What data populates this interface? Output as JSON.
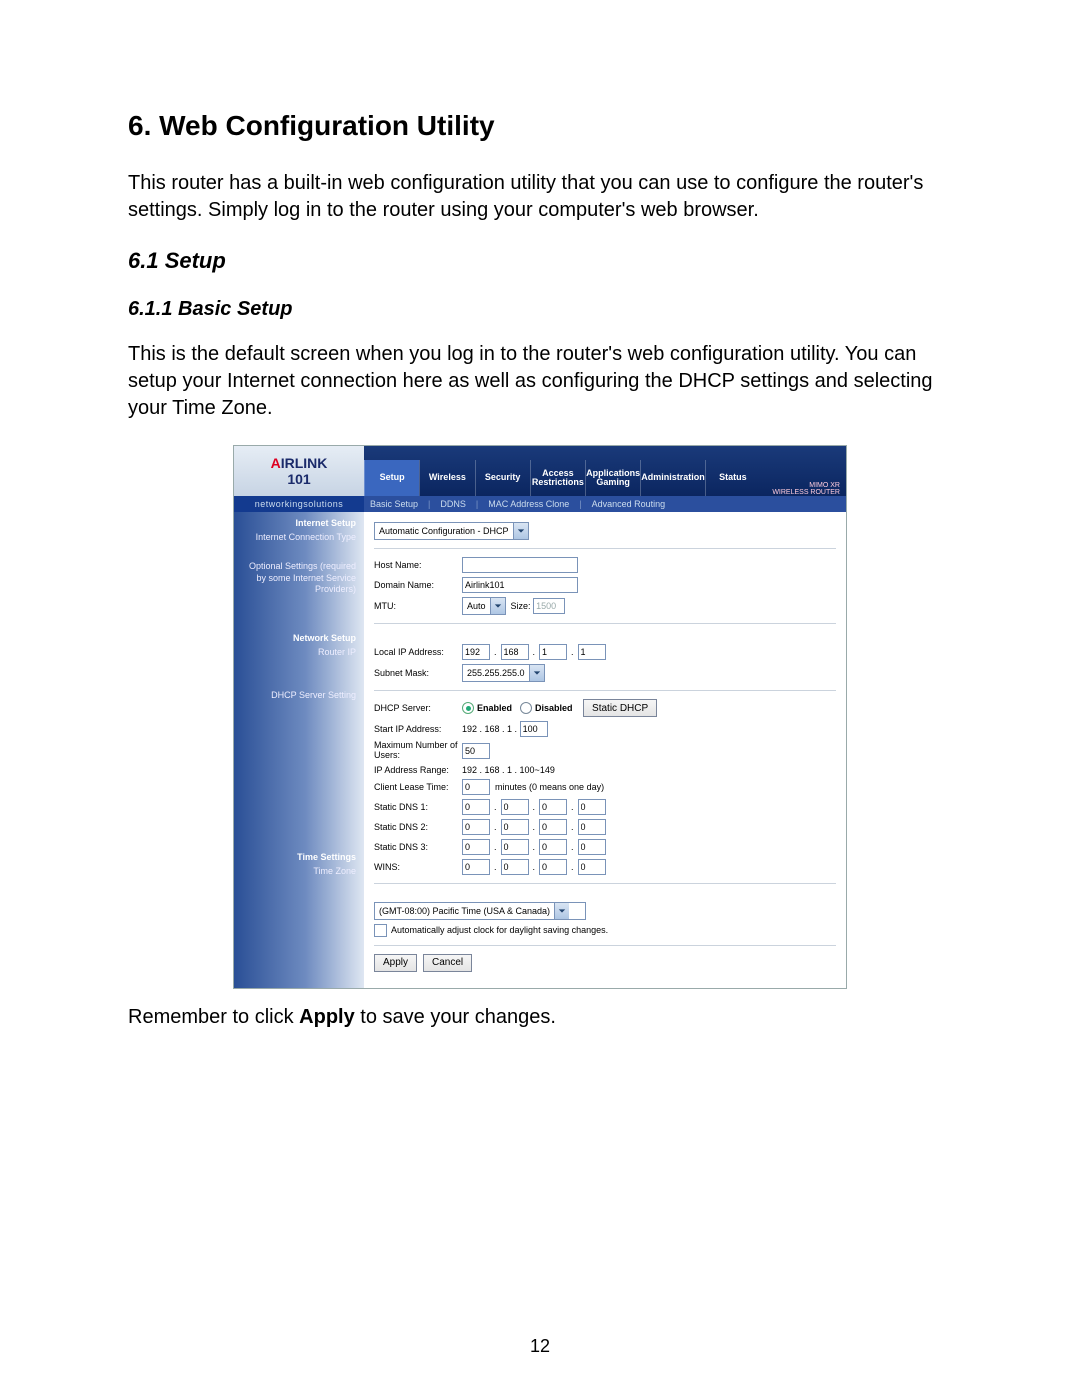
{
  "doc": {
    "h1": "6. Web Configuration Utility",
    "intro": "This router has a built-in web configuration utility that you can use to configure the router's settings. Simply log in to the router using your computer's web browser.",
    "h2": "6.1 Setup",
    "h3": "6.1.1 Basic Setup",
    "para2": "This is the default screen when you log in to the router's web configuration utility. You can setup your Internet connection here as well as configuring the DHCP settings and selecting your Time Zone.",
    "outro_pre": "Remember to click ",
    "outro_bold": "Apply",
    "outro_post": " to save your changes.",
    "pagenum": "12"
  },
  "router": {
    "badge_line1": "MIMO XR",
    "badge_line2": "WIRELESS ROUTER",
    "brand": {
      "pre": "A",
      "mid": "IRLINK",
      "small": "101"
    },
    "brandline": "networkingsolutions",
    "tabs": [
      "Setup",
      "Wireless",
      "Security",
      "Access Restrictions",
      "Applications Gaming",
      "Administration",
      "Status"
    ],
    "active_tab": 0,
    "subtabs": [
      "Basic Setup",
      "DDNS",
      "MAC Address Clone",
      "Advanced Routing"
    ],
    "left": {
      "internet_setup": "Internet Setup",
      "ict": "Internet Connection Type",
      "opt_settings": "Optional Settings (required by some Internet Service Providers)",
      "network_setup": "Network Setup",
      "router_ip": "Router IP",
      "dhcp_setting": "DHCP Server Setting",
      "time_settings": "Time Settings",
      "time_zone": "Time Zone"
    },
    "fields": {
      "conn_type": "Automatic Configuration - DHCP",
      "host_name_label": "Host Name:",
      "host_name": "",
      "domain_name_label": "Domain Name:",
      "domain_name": "Airlink101",
      "mtu_label": "MTU:",
      "mtu_mode": "Auto",
      "mtu_size_label": "Size:",
      "mtu_size": "1500",
      "local_ip_label": "Local IP Address:",
      "local_ip": [
        "192",
        "168",
        "1",
        "1"
      ],
      "subnet_label": "Subnet Mask:",
      "subnet": "255.255.255.0",
      "dhcp_server_label": "DHCP Server:",
      "enabled": "Enabled",
      "disabled": "Disabled",
      "static_dhcp_btn": "Static DHCP",
      "start_ip_label": "Start IP Address:",
      "start_ip_prefix": "192 . 168 . 1 .",
      "start_ip_last": "100",
      "max_users_label": "Maximum Number of Users:",
      "max_users": "50",
      "ip_range_label": "IP Address Range:",
      "ip_range": "192 . 168 . 1 . 100~149",
      "lease_label": "Client Lease Time:",
      "lease": "0",
      "lease_suffix": "minutes (0 means one day)",
      "dns1_label": "Static DNS 1:",
      "dns2_label": "Static DNS 2:",
      "dns3_label": "Static DNS 3:",
      "wins_label": "WINS:",
      "zero": "0",
      "tz": "(GMT-08:00) Pacific Time (USA & Canada)",
      "dst_label": "Automatically adjust clock for daylight saving changes.",
      "apply": "Apply",
      "cancel": "Cancel"
    }
  }
}
